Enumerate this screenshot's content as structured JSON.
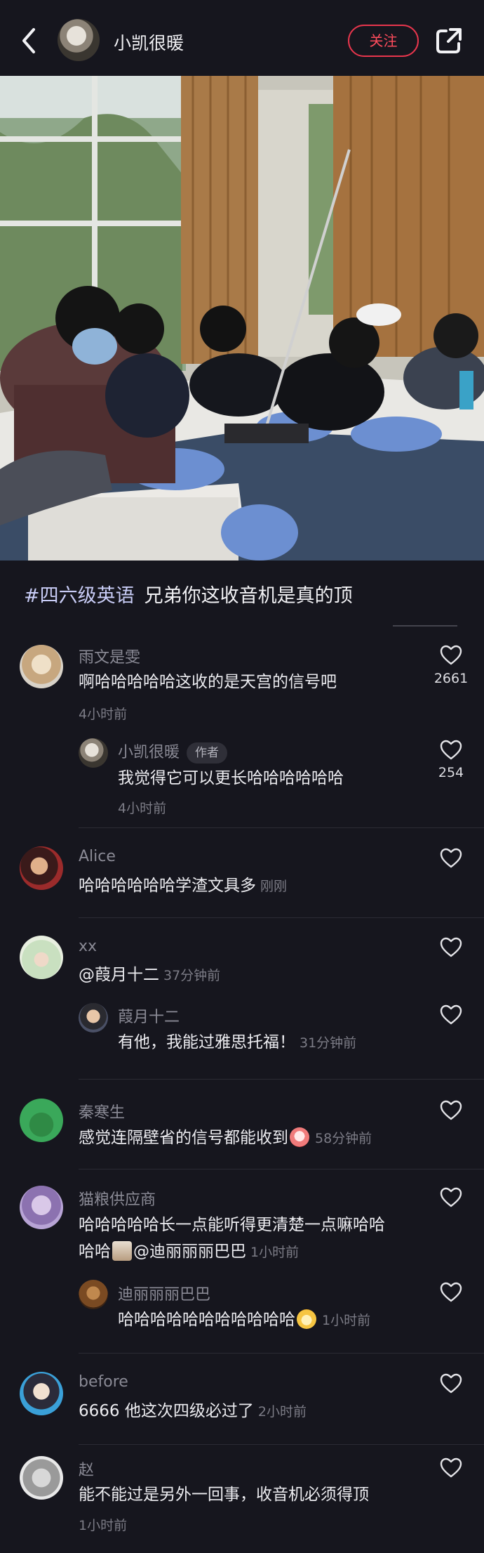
{
  "header": {
    "username": "小凯很暖",
    "follow_label": "关注"
  },
  "post": {
    "hashtag": "#四六级英语",
    "caption": "兄弟你这收音机是真的顶"
  },
  "comments": [
    {
      "user": "雨文是雯",
      "text": "啊哈哈哈哈哈这收的是天宫的信号吧",
      "time": "4小时前",
      "likes": "2661",
      "replies": [
        {
          "user": "小凯很暖",
          "badge": "作者",
          "text": "我觉得它可以更长哈哈哈哈哈哈",
          "time": "4小时前",
          "likes": "254"
        }
      ]
    },
    {
      "user": "Alice",
      "text": "哈哈哈哈哈哈学渣文具多",
      "time": "刚刚"
    },
    {
      "user": "xx",
      "text": "@葭月十二",
      "time": "37分钟前",
      "replies": [
        {
          "user": "葭月十二",
          "text": "有他，我能过雅思托福！",
          "time": "31分钟前"
        }
      ]
    },
    {
      "user": "秦寒生",
      "text": "感觉连隔壁省的信号都能收到",
      "time": "58分钟前"
    },
    {
      "user": "猫粮供应商",
      "text": "哈哈哈哈哈长一点能听得更清楚一点嘛哈哈",
      "text2": "哈哈",
      "mention": "@迪丽丽丽巴巴",
      "time": "1小时前",
      "replies": [
        {
          "user": "迪丽丽丽巴巴",
          "text": "哈哈哈哈哈哈哈哈哈哈哈",
          "time": "1小时前"
        }
      ]
    },
    {
      "user": "before",
      "text": "6666  他这次四级必过了",
      "time": "2小时前"
    },
    {
      "user": "赵",
      "text": "能不能过是另外一回事，收音机必须得顶",
      "time": "1小时前"
    }
  ],
  "colors": {
    "background": "#16161e",
    "accent": "#e8364d",
    "hashtag": "#c9cdf7"
  },
  "icons": [
    "back-icon",
    "share-icon",
    "heart-icon"
  ]
}
